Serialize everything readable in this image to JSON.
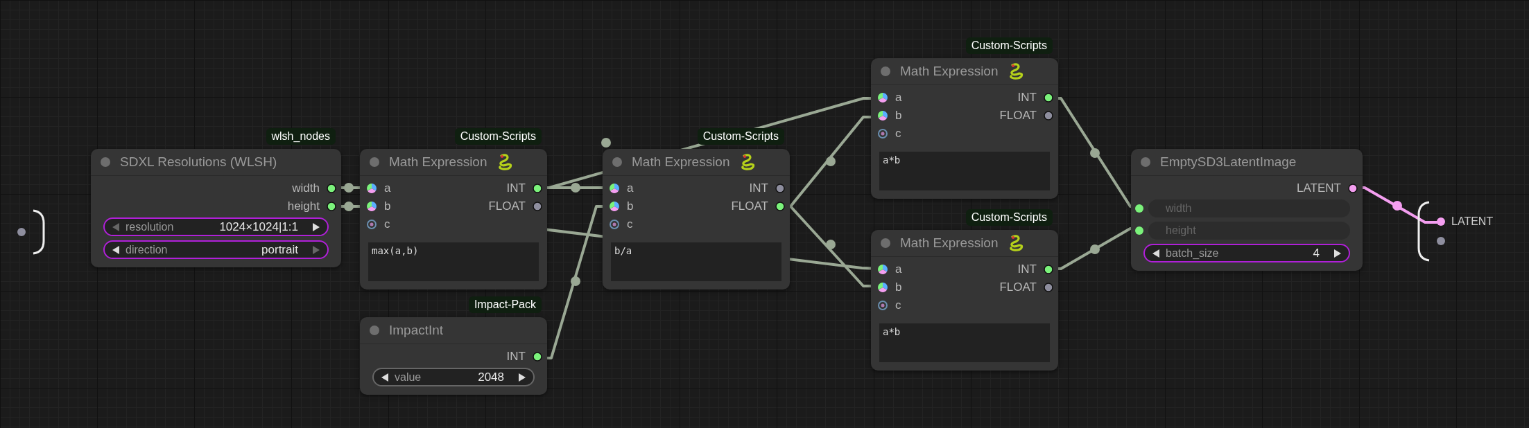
{
  "canvas": {
    "nodes": [
      {
        "badge": "wlsh_nodes",
        "title": "SDXL Resolutions (WLSH)",
        "title_icon": false,
        "outputs": [
          {
            "label": "width",
            "color": "#7bf27b"
          },
          {
            "label": "height",
            "color": "#7bf27b"
          }
        ],
        "widgets": [
          {
            "kind": "combo",
            "label": "resolution",
            "value": "1024×1024|1:1",
            "highlighted": true,
            "prev_enabled": false,
            "next_enabled": true
          },
          {
            "kind": "combo",
            "label": "direction",
            "value": "portrait",
            "highlighted": true,
            "prev_enabled": true,
            "next_enabled": false
          }
        ]
      },
      {
        "badge": "Custom-Scripts",
        "title": "Math Expression",
        "title_icon": true,
        "inputs": [
          {
            "label": "a",
            "connected": true
          },
          {
            "label": "b",
            "connected": true
          },
          {
            "label": "c",
            "connected": false
          }
        ],
        "outputs": [
          {
            "label": "INT",
            "color": "#7bf27b"
          },
          {
            "label": "FLOAT",
            "color": "#8e8e9e"
          }
        ],
        "widgets": [
          {
            "kind": "text",
            "value": "max(a,b)"
          }
        ]
      },
      {
        "badge": "Custom-Scripts",
        "title": "Math Expression",
        "title_icon": true,
        "inputs": [
          {
            "label": "a",
            "connected": true
          },
          {
            "label": "b",
            "connected": true
          },
          {
            "label": "c",
            "connected": false
          }
        ],
        "outputs": [
          {
            "label": "INT",
            "color": "#8e8e9e"
          },
          {
            "label": "FLOAT",
            "color": "#7bf27b"
          }
        ],
        "widgets": [
          {
            "kind": "text",
            "value": "b/a"
          }
        ]
      },
      {
        "badge": "Custom-Scripts",
        "title": "Math Expression",
        "title_icon": true,
        "inputs": [
          {
            "label": "a",
            "connected": true
          },
          {
            "label": "b",
            "connected": true
          },
          {
            "label": "c",
            "connected": false
          }
        ],
        "outputs": [
          {
            "label": "INT",
            "color": "#7bf27b"
          },
          {
            "label": "FLOAT",
            "color": "#8e8e9e"
          }
        ],
        "widgets": [
          {
            "kind": "text",
            "value": "a*b"
          }
        ]
      },
      {
        "badge": "Custom-Scripts",
        "title": "Math Expression",
        "title_icon": true,
        "inputs": [
          {
            "label": "a",
            "connected": true
          },
          {
            "label": "b",
            "connected": true
          },
          {
            "label": "c",
            "connected": false
          }
        ],
        "outputs": [
          {
            "label": "INT",
            "color": "#7bf27b"
          },
          {
            "label": "FLOAT",
            "color": "#8e8e9e"
          }
        ],
        "widgets": [
          {
            "kind": "text",
            "value": "a*b"
          }
        ]
      },
      {
        "badge": "Impact-Pack",
        "title": "ImpactInt",
        "title_icon": false,
        "outputs": [
          {
            "label": "INT",
            "color": "#7bf27b"
          }
        ],
        "widgets": [
          {
            "kind": "number",
            "label": "value",
            "value": "2048",
            "highlighted": false,
            "prev_enabled": true,
            "next_enabled": true
          }
        ]
      },
      {
        "title": "EmptySD3LatentImage",
        "title_icon": false,
        "outputs": [
          {
            "label": "LATENT",
            "color": "#f49ef0"
          }
        ],
        "widgets": [
          {
            "kind": "converted",
            "label": "width",
            "connected": true
          },
          {
            "kind": "converted",
            "label": "height",
            "connected": true
          },
          {
            "kind": "number",
            "label": "batch_size",
            "value": "4",
            "highlighted": true,
            "prev_enabled": true,
            "next_enabled": true
          }
        ]
      }
    ],
    "input_group": {
      "slots": [
        {
          "color": "#8e8e9e"
        }
      ]
    },
    "output_group": {
      "slots": [
        {
          "label": "LATENT",
          "color": "#f49ef0"
        },
        {
          "color": "#8e8e9e"
        }
      ]
    }
  }
}
